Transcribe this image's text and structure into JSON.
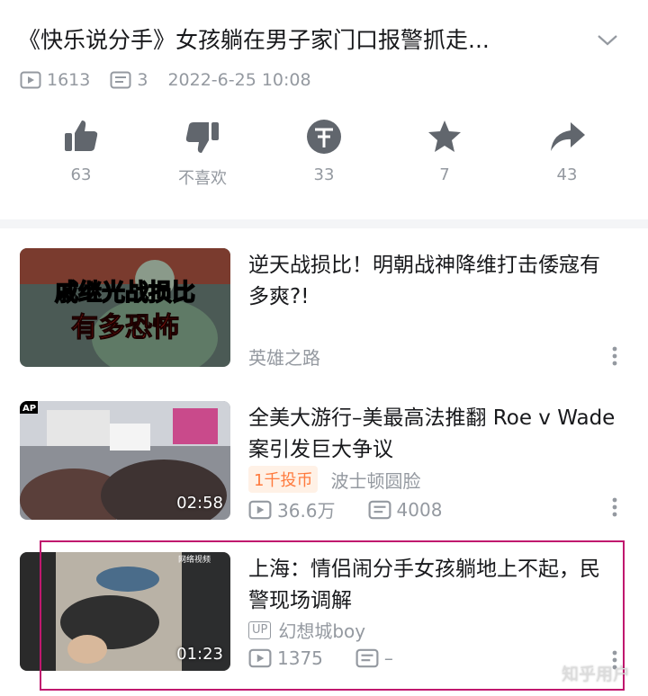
{
  "video": {
    "title": "《快乐说分手》女孩躺在男子家门口报警抓走...",
    "views": "1613",
    "comments": "3",
    "date": "2022-6-25 10:08"
  },
  "actions": [
    {
      "icon": "thumbs-up-icon",
      "label": "63"
    },
    {
      "icon": "thumbs-down-icon",
      "label": "不喜欢"
    },
    {
      "icon": "coin-icon",
      "label": "33"
    },
    {
      "icon": "star-icon",
      "label": "7"
    },
    {
      "icon": "share-icon",
      "label": "43"
    }
  ],
  "recommendations": [
    {
      "title": "逆天战损比！明朝战神降维打击倭寇有多爽?!",
      "thumb_text_1": "戚继光战损比",
      "thumb_text_2": "有多恐怖",
      "author": "英雄之路"
    },
    {
      "title": "全美大游行–美最高法推翻 Roe v Wade 案引发巨大争议",
      "thumb_tag": "AP",
      "duration": "02:58",
      "badge": "1千投币",
      "author": "波士顿圆脸",
      "views": "36.6万",
      "comments": "4008"
    },
    {
      "title": "上海：情侣闹分手女孩躺地上不起，民警现场调解",
      "thumb_tag": "网络视频",
      "duration": "01:23",
      "up_tag": "UP",
      "author": "幻想城boy",
      "views": "1375",
      "comments": "–"
    }
  ],
  "watermark": "知乎用户",
  "colors": {
    "text": "#18191c",
    "muted": "#9499a0",
    "highlight": "#c0186e",
    "badge": "#ff7a3d"
  }
}
